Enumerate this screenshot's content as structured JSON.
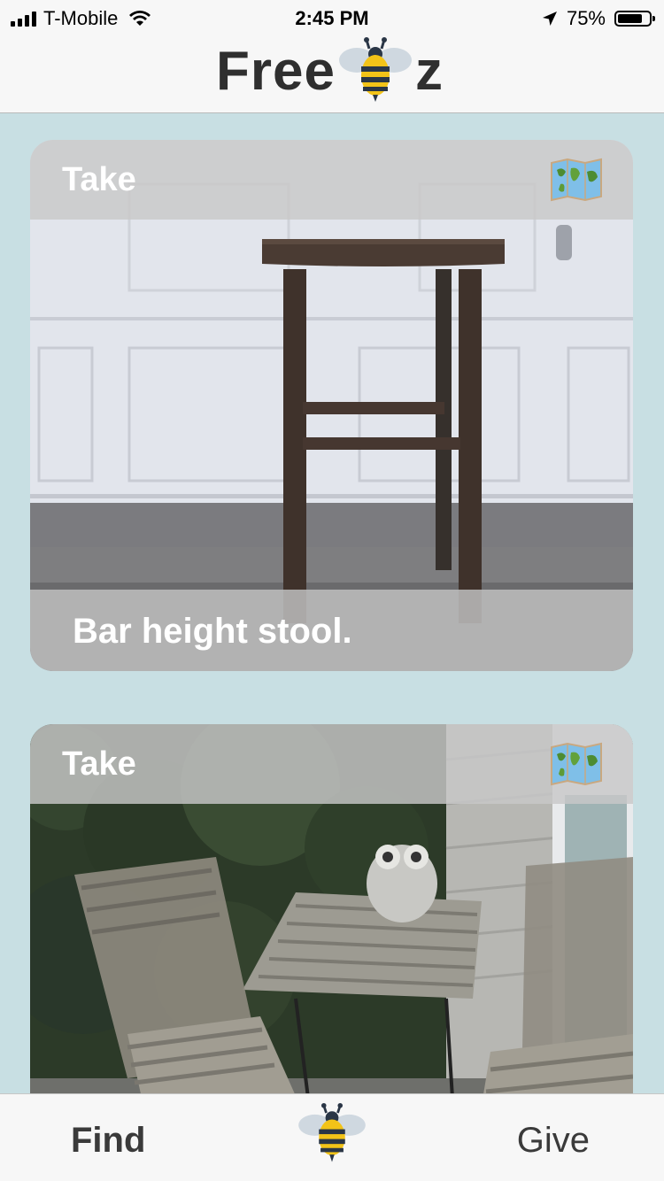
{
  "status_bar": {
    "carrier": "T-Mobile",
    "time": "2:45 PM",
    "battery": "75%",
    "battery_level": 0.75
  },
  "header": {
    "logo_text_left": "Free",
    "logo_text_right": "z",
    "logo_icon": "bee-icon"
  },
  "feed": {
    "cards": [
      {
        "action": "Take",
        "caption": "Bar height stool.",
        "map_icon": "map-icon",
        "photo": "bar-stool-photo"
      },
      {
        "action": "Take",
        "caption": "",
        "map_icon": "map-icon",
        "photo": "patio-set-photo"
      }
    ]
  },
  "tab_bar": {
    "find_label": "Find",
    "give_label": "Give",
    "center_icon": "bee-icon"
  },
  "colors": {
    "background": "#c8dfe3",
    "bar_background": "#f7f7f7",
    "bee_yellow": "#f2c318",
    "bee_dark": "#2a3646"
  }
}
